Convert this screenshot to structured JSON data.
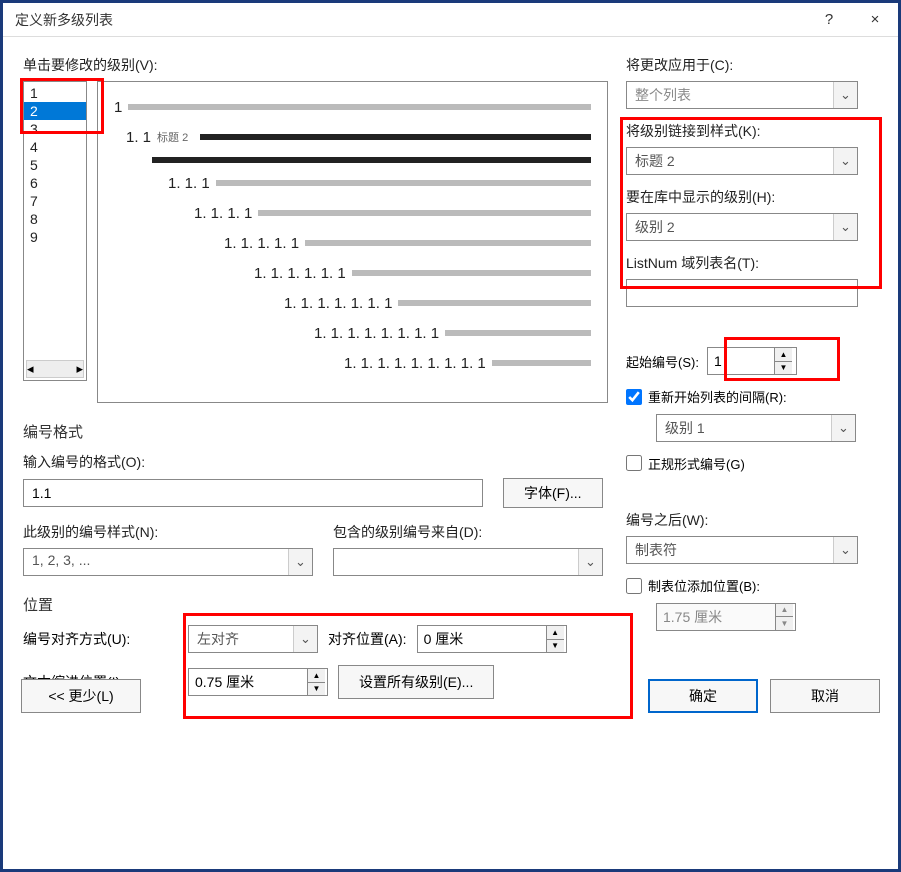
{
  "window": {
    "title": "定义新多级列表",
    "help": "?",
    "close": "×"
  },
  "labels": {
    "click_level": "单击要修改的级别(V):",
    "apply_to": "将更改应用于(C):",
    "link_level": "将级别链接到样式(K):",
    "show_in_lib": "要在库中显示的级别(H):",
    "listnum_name": "ListNum 域列表名(T):",
    "number_format": "编号格式",
    "enter_format": "输入编号的格式(O):",
    "font_btn": "字体(F)...",
    "start_at": "起始编号(S):",
    "restart_label": "重新开始列表的间隔(R):",
    "this_level_style": "此级别的编号样式(N):",
    "include_from": "包含的级别编号来自(D):",
    "legal": "正规形式编号(G)",
    "position": "位置",
    "align": "编号对齐方式(U):",
    "align_at": "对齐位置(A):",
    "text_indent": "文本缩进位置(I):",
    "set_all": "设置所有级别(E)...",
    "follow": "编号之后(W):",
    "tab_add": "制表位添加位置(B):",
    "less_btn": "<< 更少(L)",
    "ok": "确定",
    "cancel": "取消"
  },
  "values": {
    "levels": [
      "1",
      "2",
      "3",
      "4",
      "5",
      "6",
      "7",
      "8",
      "9"
    ],
    "selected_level": "2",
    "apply_to": "整个列表",
    "link_style": "标题 2",
    "show_level": "级别 2",
    "listnum_name": "",
    "format_value": "1.1",
    "start_at": "1",
    "restart_checked": true,
    "restart_level": "级别 1",
    "legal_checked": false,
    "number_style": "1, 2, 3, ...",
    "include_from": "",
    "align": "左对齐",
    "align_at": "0 厘米",
    "text_indent": "0.75 厘米",
    "follow": "制表符",
    "tab_add_checked": false,
    "tab_add_value": "1.75 厘米"
  },
  "preview": {
    "lv2_text": "标题 2",
    "items": [
      {
        "num": "1",
        "indent": 0
      },
      {
        "num": "1. 1",
        "indent": 12,
        "label": true,
        "dark": true
      },
      {
        "num": "1. 1. 1",
        "indent": 54
      },
      {
        "num": "1. 1. 1. 1",
        "indent": 80
      },
      {
        "num": "1. 1. 1. 1. 1",
        "indent": 110
      },
      {
        "num": "1. 1. 1. 1. 1. 1",
        "indent": 140
      },
      {
        "num": "1. 1. 1. 1. 1. 1. 1",
        "indent": 170
      },
      {
        "num": "1. 1. 1. 1. 1. 1. 1. 1",
        "indent": 200
      },
      {
        "num": "1. 1. 1. 1. 1. 1. 1. 1. 1",
        "indent": 230
      }
    ]
  }
}
